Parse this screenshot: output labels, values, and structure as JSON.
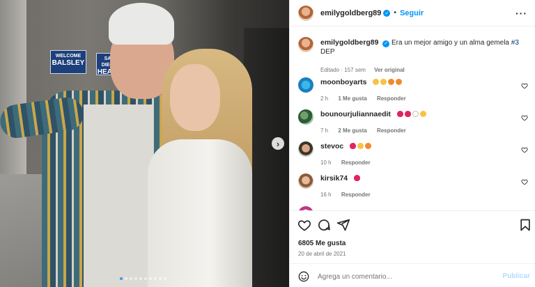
{
  "header": {
    "username": "emilygoldberg89",
    "separator": "•",
    "follow_label": "Seguir",
    "more_icon": "more-horizontal-icon"
  },
  "photo": {
    "sign1_line1": "WELCOME",
    "sign1_line2": "BALSLEY",
    "sign2_line1": "SAN DIEGO",
    "sign2_line2": "HEADL",
    "next_icon": "chevron-right-icon",
    "slide_count": 10,
    "active_slide": 1
  },
  "caption": {
    "username": "emilygoldberg89",
    "text": "Era un mejor amigo y un alma gemela",
    "hashtag": "#3",
    "text2": "DEP",
    "edited": "Editado",
    "dot": "·",
    "age": "157 sem",
    "see_original": "Ver original"
  },
  "comments": [
    {
      "username": "moonboyarts",
      "time": "2 h",
      "likes": "1 Me gusta",
      "reply": "Responder"
    },
    {
      "username": "bounourjuliannaedit",
      "time": "7 h",
      "likes": "2 Me gusta",
      "reply": "Responder"
    },
    {
      "username": "stevoc",
      "time": "10 h",
      "reply": "Responder"
    },
    {
      "username": "kirsik74",
      "time": "16 h",
      "reply": "Responder"
    }
  ],
  "actions": {
    "likes": "6805 Me gusta",
    "date": "20 de abril de 2021"
  },
  "add_comment": {
    "placeholder": "Agrega un comentario...",
    "publish_label": "Publicar"
  },
  "colors": {
    "accent": "#0095f6",
    "text": "#262626",
    "secondary": "#737373",
    "heart": "#e0245e"
  }
}
